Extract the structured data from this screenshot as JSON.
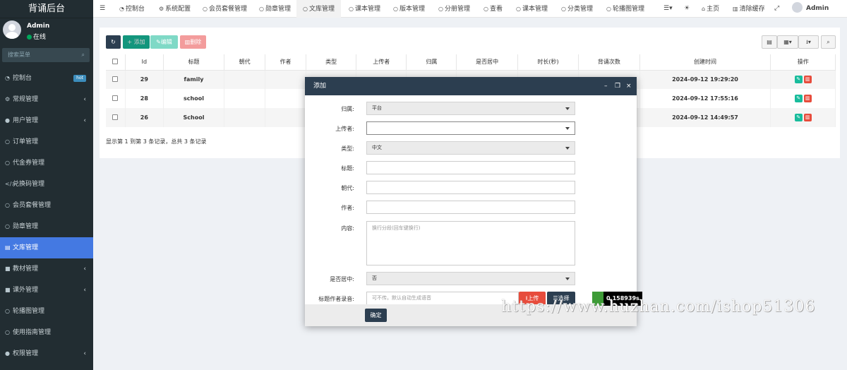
{
  "sidebar": {
    "title": "背诵后台",
    "user": {
      "name": "Admin",
      "status": "在线"
    },
    "search_placeholder": "搜索菜单",
    "items": [
      {
        "label": "控制台",
        "icon": "dashboard-icon",
        "badge": "hot"
      },
      {
        "label": "常规管理",
        "icon": "cogs-icon",
        "has_children": true
      },
      {
        "label": "用户管理",
        "icon": "user-icon",
        "has_children": true
      },
      {
        "label": "订单管理",
        "icon": "circle-icon"
      },
      {
        "label": "代金券管理",
        "icon": "circle-icon"
      },
      {
        "label": "兑换码管理",
        "icon": "code-icon"
      },
      {
        "label": "会员套餐管理",
        "icon": "circle-icon"
      },
      {
        "label": "勋章管理",
        "icon": "circle-icon"
      },
      {
        "label": "文库管理",
        "icon": "file-icon",
        "active": true
      },
      {
        "label": "教材管理",
        "icon": "book-icon",
        "has_children": true
      },
      {
        "label": "课外管理",
        "icon": "book-icon",
        "has_children": true
      },
      {
        "label": "轮播图管理",
        "icon": "circle-icon"
      },
      {
        "label": "使用指南管理",
        "icon": "circle-icon"
      },
      {
        "label": "权限管理",
        "icon": "group-icon",
        "has_children": true
      }
    ]
  },
  "topnav": {
    "tabs": [
      {
        "label": "控制台"
      },
      {
        "label": "系统配置"
      },
      {
        "label": "会员套餐管理"
      },
      {
        "label": "勋章管理"
      },
      {
        "label": "文库管理",
        "active": true
      },
      {
        "label": "课本管理"
      },
      {
        "label": "版本管理"
      },
      {
        "label": "分册管理"
      },
      {
        "label": "查看"
      },
      {
        "label": "课本管理"
      },
      {
        "label": "分类管理"
      },
      {
        "label": "轮播图管理"
      }
    ],
    "home_label": "主页",
    "clear_cache_label": "清除缓存",
    "user_name": "Admin"
  },
  "toolbar": {
    "add_label": "添加",
    "edit_label": "编辑",
    "delete_label": "删除"
  },
  "table": {
    "headers": [
      "Id",
      "标题",
      "朝代",
      "作者",
      "类型",
      "上传者",
      "归属",
      "是否居中",
      "时长(秒)",
      "背诵次数",
      "创建时间",
      "操作"
    ],
    "rows": [
      {
        "id": "29",
        "title": "family",
        "created": "2024-09-12 19:29:20"
      },
      {
        "id": "28",
        "title": "school",
        "created": "2024-09-12 17:55:16"
      },
      {
        "id": "26",
        "title": "School",
        "created": "2024-09-12 14:49:57"
      }
    ],
    "pagination_text": "显示第 1 到第 3 条记录，总共 3 条记录"
  },
  "modal": {
    "title": "添加",
    "fields": {
      "belong_label": "归属:",
      "belong_value": "平台",
      "uploader_label": "上传者:",
      "uploader_value": "",
      "type_label": "类型:",
      "type_value": "中文",
      "title_label": "标题:",
      "title_value": "",
      "dynasty_label": "朝代:",
      "dynasty_value": "",
      "author_label": "作者:",
      "author_value": "",
      "content_label": "内容:",
      "content_placeholder": "换行分段(回车键换行)",
      "center_label": "是否居中:",
      "center_value": "否",
      "audio_label": "标题作者录音:",
      "audio_placeholder": "可不传。默认自动生成语音",
      "upload_label": "上传",
      "choose_label": "选择"
    },
    "confirm_label": "确定"
  },
  "timer": "0.158939s",
  "watermark": "https://www.huzhan.com/ishop51306"
}
